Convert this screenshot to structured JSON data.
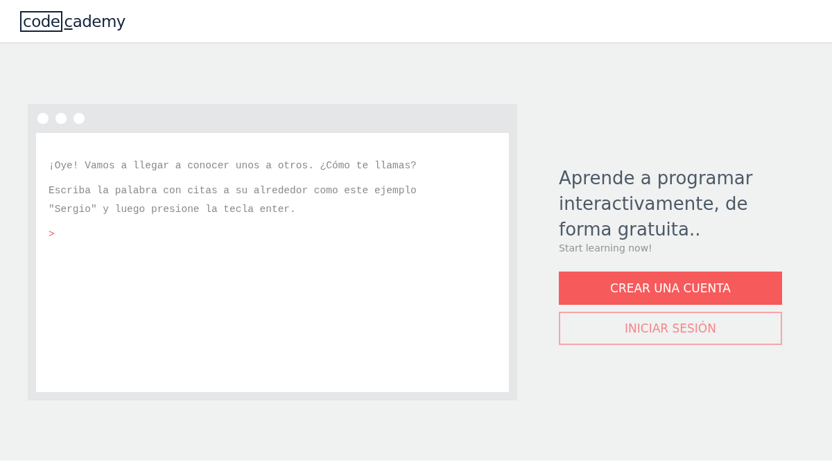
{
  "header": {
    "logo": {
      "boxed": "code",
      "rest": "cademy"
    }
  },
  "console": {
    "lines": [
      "¡Oye! Vamos a llegar a conocer unos a otros. ¿Cómo te llamas?",
      "Escriba la palabra con citas a su alrededor como este ejemplo \"Sergio\" y luego presione la tecla enter."
    ],
    "prompt": ">"
  },
  "hero": {
    "heading": "Aprende a programar interactivamente, de forma gratuita..",
    "subtitle": "Start learning now!"
  },
  "buttons": [
    {
      "label": "CREAR UNA CUENTA",
      "kind": "primary"
    },
    {
      "label": "INICIAR SESIÓN",
      "kind": "outline"
    }
  ]
}
